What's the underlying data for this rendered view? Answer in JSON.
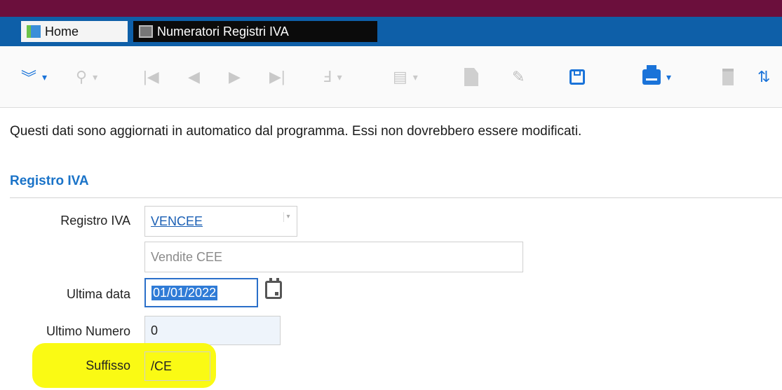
{
  "tabs": [
    {
      "label": "Home",
      "icon": "home-icon",
      "active": false
    },
    {
      "label": "Numeratori Registri IVA",
      "icon": "document-icon",
      "active": true
    }
  ],
  "toolbar": {
    "items": [
      "expand-icon",
      "search-icon",
      "first-record-icon",
      "previous-record-icon",
      "next-record-icon",
      "last-record-icon",
      "attachment-icon",
      "database-icon",
      "new-document-icon",
      "edit-icon",
      "save-icon",
      "print-icon",
      "delete-icon",
      "refresh-icon"
    ]
  },
  "info_message": "Questi dati sono aggiornati in automatico dal programma. Essi non dovrebbero essere modificati.",
  "section_title": "Registro IVA",
  "form": {
    "registro_label": "Registro IVA",
    "registro_value": "VENCEE",
    "registro_description": "Vendite CEE",
    "ultima_data_label": "Ultima data",
    "ultima_data_value": "01/01/2022",
    "ultimo_numero_label": "Ultimo Numero",
    "ultimo_numero_value": "0",
    "suffisso_label": "Suffisso",
    "suffisso_value": "/CE"
  },
  "colors": {
    "accent": "#1a73d9",
    "tabbar": "#0e5fa8",
    "titlebar": "#6b0f3c",
    "highlight": "#fafa14"
  }
}
